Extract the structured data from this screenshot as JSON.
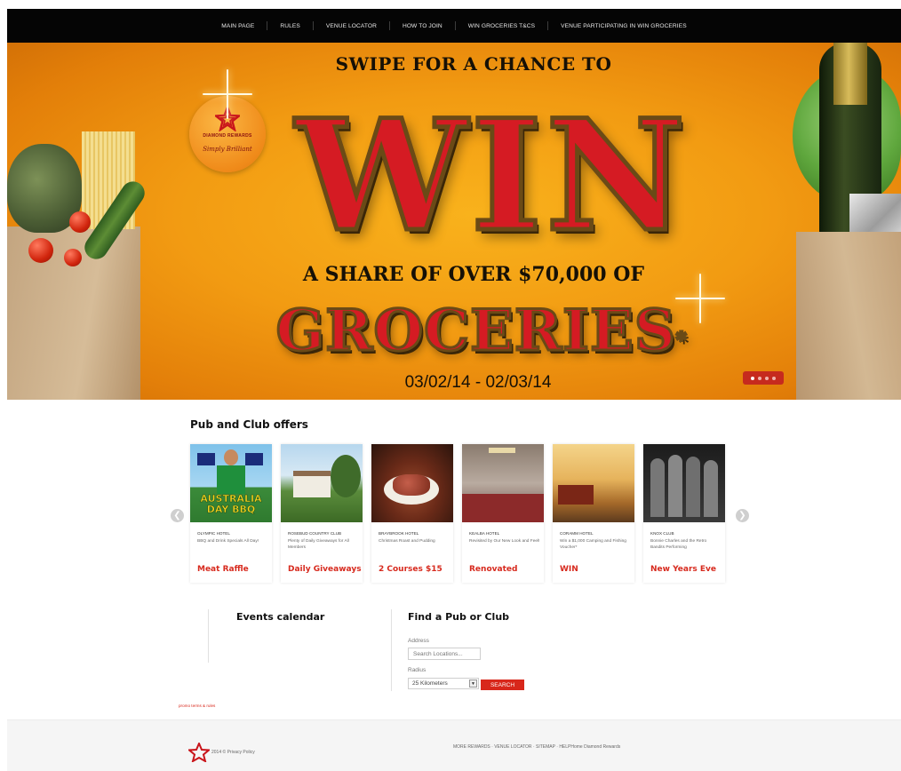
{
  "nav": {
    "items": [
      "MAIN PAGE",
      "RULES",
      "VENUE LOCATOR",
      "HOW TO JOIN",
      "WIN GROCERIES T&CS",
      "VENUE PARTICIPATING IN WIN GROCERIES"
    ]
  },
  "hero": {
    "headline": "SWIPE FOR A CHANCE TO",
    "win": "WIN",
    "share": "A SHARE OF OVER $70,000 OF",
    "groceries": "GROCERIES",
    "asterisk": "*",
    "dates": "03/02/14 - 02/03/14",
    "logo_name": "DIAMOND REWARDS",
    "logo_tag": "Simply Brilliant",
    "slides_total": 4,
    "slide_active": 1
  },
  "offers": {
    "title": "Pub and Club offers",
    "items": [
      {
        "venue": "OLYMPIC HOTEL",
        "desc": "BBQ and Drink Specials All Day!",
        "offer": "Meat Raffle",
        "image_text": "AUSTRALIA DAY BBQ"
      },
      {
        "venue": "ROSEBUD COUNTRY CLUB",
        "desc": "Plenty of Daily Giveaways for All Members",
        "offer": "Daily Giveaways"
      },
      {
        "venue": "BRAYBROOK HOTEL",
        "desc": "Christmas Roast and Pudding",
        "offer": "2 Courses $15"
      },
      {
        "venue": "KEALBA HOTEL",
        "desc": "Revisited by Our New Look and Feel!",
        "offer": "Renovated"
      },
      {
        "venue": "CORAMM HOTEL",
        "desc": "Win a $1,000 Camping and Fishing Voucher*",
        "offer": "WIN"
      },
      {
        "venue": "KNOX CLUB",
        "desc": "Bonnie Charles and the Retro Bandits Performing",
        "offer": "New Years Eve"
      }
    ],
    "prev_icon": "chevron-left",
    "next_icon": "chevron-right"
  },
  "events": {
    "title": "Events calendar"
  },
  "finder": {
    "title": "Find a Pub or Club",
    "address_label": "Address",
    "address_placeholder": "Search Locations...",
    "radius_label": "Radius",
    "radius_value": "25 Kilometers",
    "search_label": "SEARCH"
  },
  "promo_link": "promo terms & rules",
  "footer": {
    "copyright": "2014 © Privacy Policy",
    "links": [
      "MORE REWARDS",
      "VENUE LOCATOR",
      "SITEMAP",
      "HELPHome Diamond Rewards"
    ]
  },
  "colors": {
    "accent": "#d8271b",
    "nav_bg": "#050505",
    "hero_bg": "#f29b12"
  }
}
